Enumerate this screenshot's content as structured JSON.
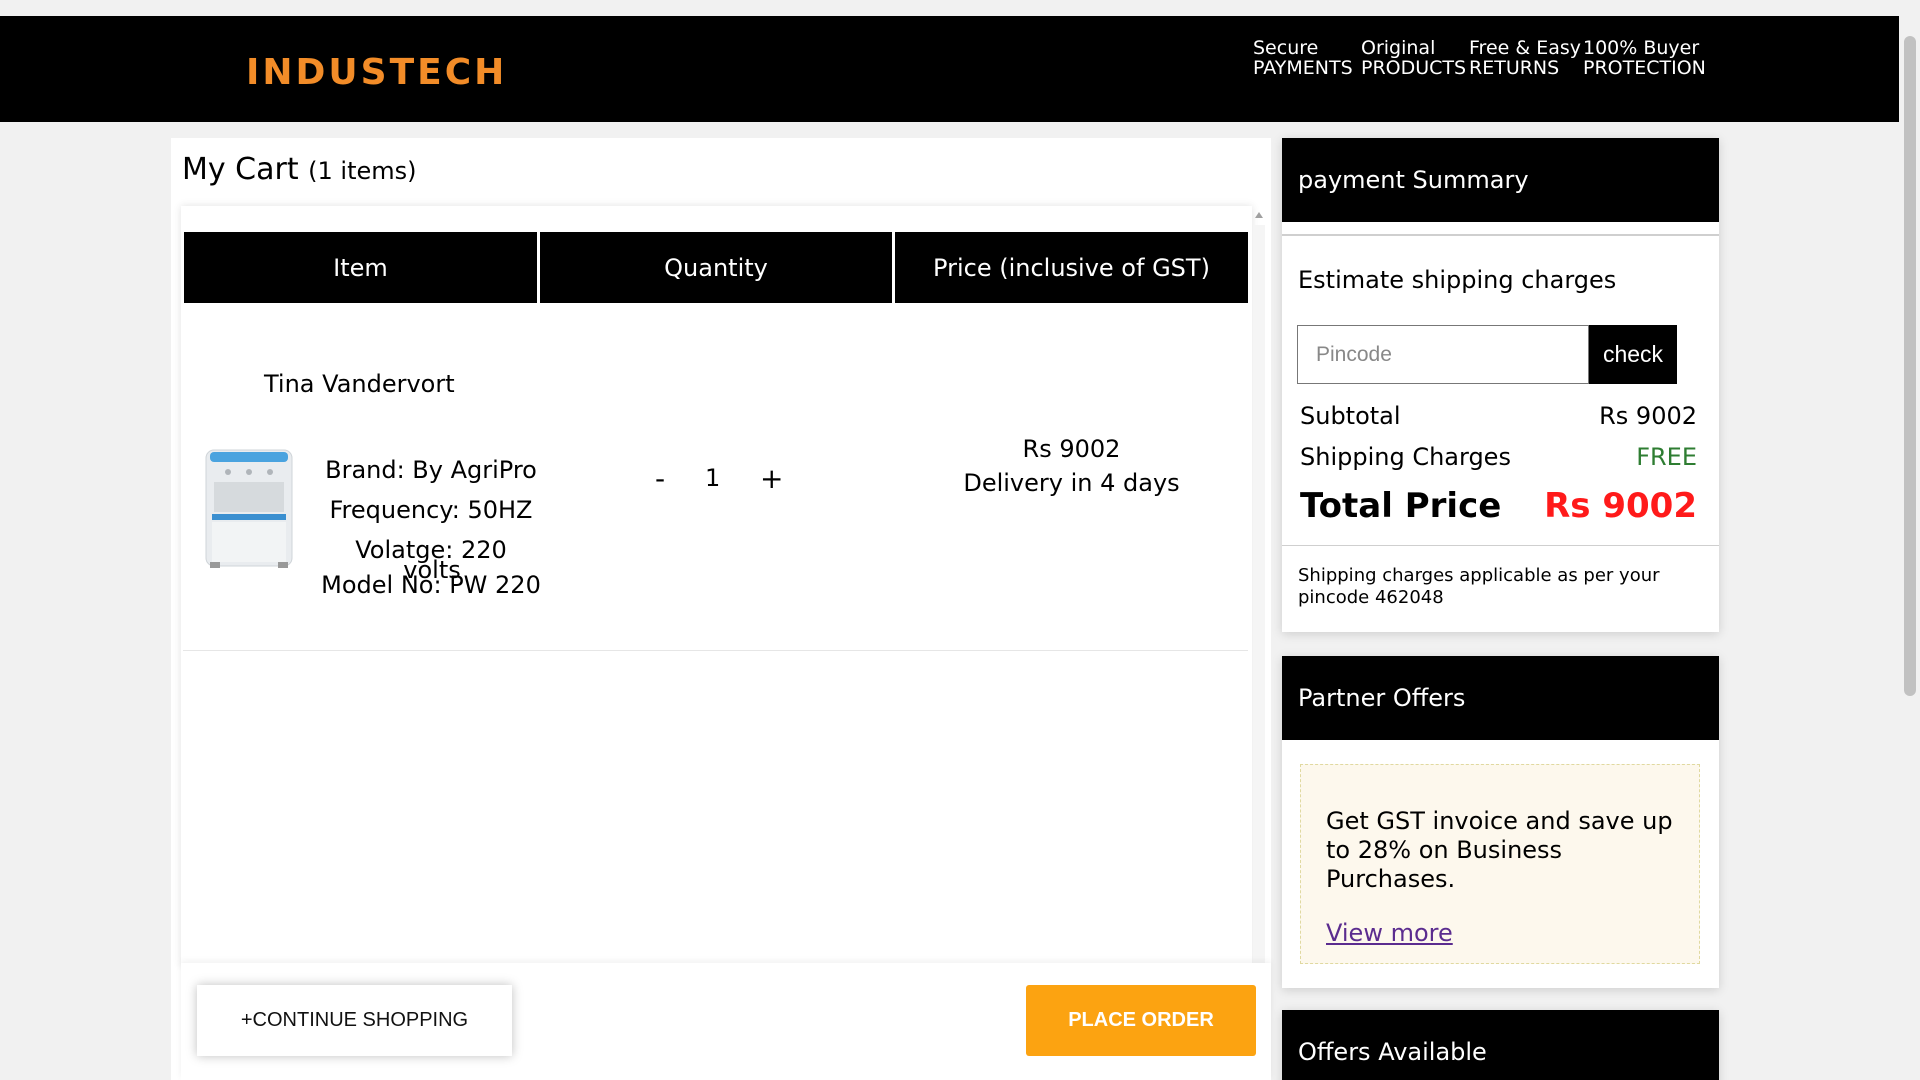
{
  "header": {
    "logo": "INDUSTECH",
    "features": [
      {
        "line1": "Secure",
        "line2": "PAYMENTS"
      },
      {
        "line1": "Original",
        "line2": "PRODUCTS"
      },
      {
        "line1": "Free & Easy",
        "line2": "RETURNS"
      },
      {
        "line1": "100% Buyer",
        "line2": "PROTECTION"
      }
    ]
  },
  "cart": {
    "title": "My Cart",
    "count_label": "(1 items)",
    "columns": [
      "Item",
      "Quantity",
      "Price (inclusive of GST)"
    ],
    "items": [
      {
        "name": "Tina Vandervort",
        "brand": "Brand: By AgriPro",
        "frequency": "Frequency: 50HZ",
        "voltage": "Volatge: 220",
        "voltage_unit": "volts",
        "model": "Model No: PW 220",
        "minus": "-",
        "quantity": "1",
        "plus": "+",
        "price": "Rs 9002",
        "delivery": "Delivery in 4 days"
      }
    ],
    "continue_label": "+CONTINUE SHOPPING",
    "place_order_label": "PLACE ORDER"
  },
  "payment_summary": {
    "title": "payment Summary",
    "estimate_title": "Estimate shipping charges",
    "pincode_placeholder": "Pincode",
    "check_label": "check",
    "subtotal_label": "Subtotal",
    "subtotal_value": "Rs 9002",
    "shipping_label": "Shipping Charges",
    "shipping_value": "FREE",
    "total_label": "Total Price",
    "total_value": "Rs 9002",
    "note": "Shipping charges applicable as per your pincode 462048"
  },
  "partner_offers": {
    "title": "Partner Offers",
    "text": "Get GST invoice and save up to 28% on Business Purchases.",
    "link": "View more"
  },
  "offers_available": {
    "title": "Offers Available"
  },
  "colors": {
    "accent_orange": "#fca311",
    "logo_orange": "#f28c28",
    "total_red": "#ff1a1a",
    "free_green": "#2e7d32"
  }
}
